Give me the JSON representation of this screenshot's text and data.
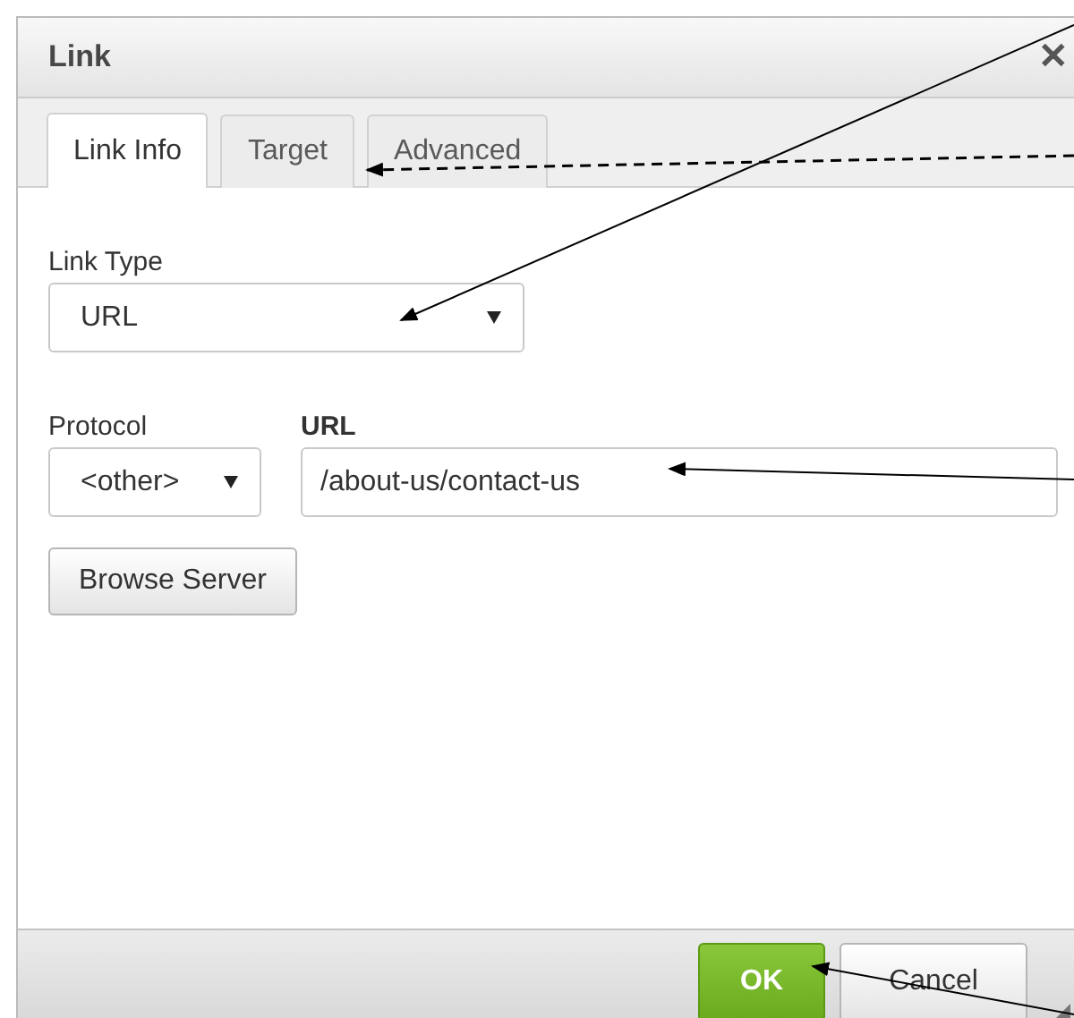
{
  "dialog": {
    "title": "Link",
    "close": "✕"
  },
  "tabs": [
    {
      "label": "Link Info",
      "selected": true
    },
    {
      "label": "Target",
      "selected": false
    },
    {
      "label": "Advanced",
      "selected": false
    }
  ],
  "link_type": {
    "label": "Link Type",
    "value": "URL"
  },
  "protocol": {
    "label": "Protocol",
    "value": "<other>"
  },
  "url": {
    "label": "URL",
    "value": "/about-us/contact-us"
  },
  "browse_button": "Browse Server",
  "footer_buttons": [
    {
      "label": "OK",
      "kind": "primary"
    },
    {
      "label": "Cancel",
      "kind": "secondary"
    }
  ]
}
